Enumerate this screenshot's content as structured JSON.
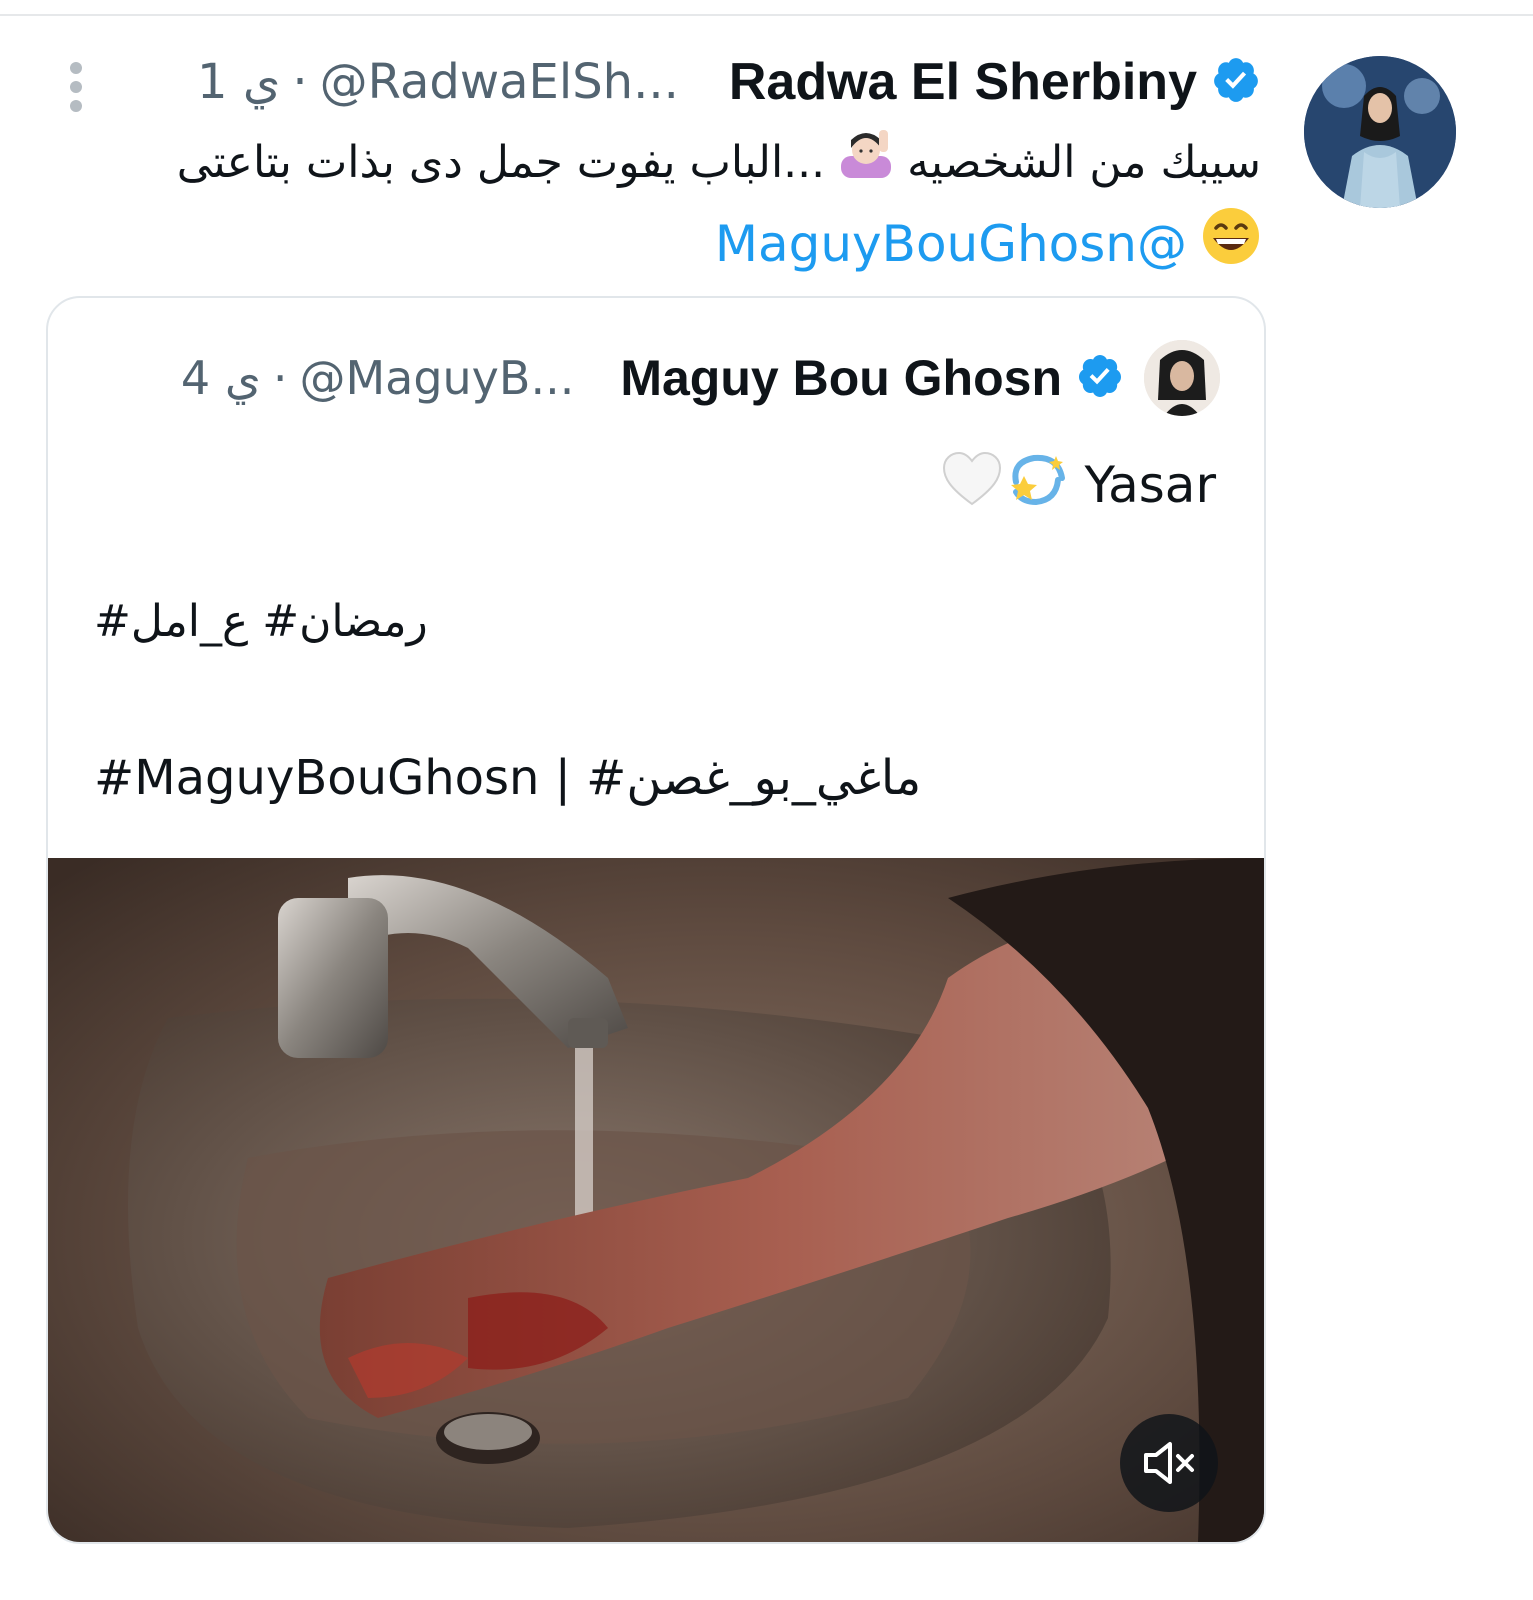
{
  "main_tweet": {
    "display_name": "Radwa El Sherbiny",
    "handle": "@RadwaElSh...",
    "time": "1 ي",
    "separator": "·",
    "text_line1_a": "سيبك من الشخصيه",
    "text_line1_b": "...الباب يفوت جمل دى بذات بتاعتى",
    "mention": "@MaguyBouGhosn",
    "icons": [
      "more-vertical-icon",
      "verified-badge-icon",
      "person-raising-hand-emoji",
      "grinning-face-emoji"
    ]
  },
  "quoted_tweet": {
    "display_name": "Maguy Bou Ghosn",
    "handle": "@MaguyB...",
    "time": "4 ي",
    "separator": "·",
    "text_name": "Yasar",
    "hashtags_ar": "رمضان# ع_امل#",
    "hashtags_mixed": "#MaguyBouGhosn | #ماغي_بو_غصن",
    "icons": [
      "verified-badge-icon",
      "dizzy-emoji",
      "white-heart-emoji",
      "muted-speaker-icon"
    ]
  },
  "colors": {
    "text": "#0f1419",
    "secondary": "#536471",
    "link": "#1d9bf0",
    "verified": "#1d9bf0",
    "border": "#e1e6ea"
  }
}
